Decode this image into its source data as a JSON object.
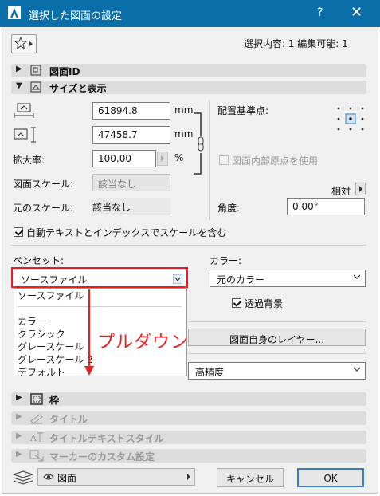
{
  "window": {
    "title": "選択した図面の設定",
    "help_label": "?",
    "close_label": "✕"
  },
  "selection_info": "選択内容: 1 編集可能: 1",
  "sections": {
    "drawing_id": "図面ID",
    "size_display": "サイズと表示",
    "frame": "枠",
    "title": "タイトル",
    "title_text_style": "タイトルテキストスタイル",
    "marker_custom": "マーカーのカスタム設定"
  },
  "size": {
    "width_value": "61894.8",
    "height_value": "47458.7",
    "unit_mm_1": "mm",
    "unit_mm_2": "mm",
    "zoom_label": "拡大率:",
    "zoom_value": "100.00",
    "zoom_unit": "%",
    "drawing_scale_label": "図面スケール:",
    "drawing_scale_value": "該当なし",
    "original_scale_label": "元のスケール:",
    "original_scale_value": "該当なし",
    "auto_text_label": "自動テキストとインデックスでスケールを含む",
    "auto_text_checked": true
  },
  "anchor": {
    "label": "配置基準点:",
    "origin_label": "図面内部原点を使用",
    "relative_label": "相対",
    "angle_label": "角度:",
    "angle_value": "0.00°"
  },
  "pen": {
    "label": "ペンセット:",
    "selected": "ソースファイル",
    "options": [
      "ソースファイル",
      "カラー",
      "クラシック",
      "グレースケール",
      "グレースケール 2",
      "デフォルト"
    ]
  },
  "color": {
    "label": "カラー:",
    "selected": "元のカラー",
    "transparent_label": "透過背景",
    "transparent_checked": true
  },
  "layer_button": "図面自身のレイヤー...",
  "quality_selected": "高精度",
  "annotation": "プルダウン",
  "footer": {
    "layer_view": "図面",
    "cancel": "キャンセル",
    "ok": "OK"
  },
  "colors": {
    "titlebar": "#0a6fa8",
    "annotation_red": "#e62020",
    "ok_border": "#3c7fc1"
  }
}
